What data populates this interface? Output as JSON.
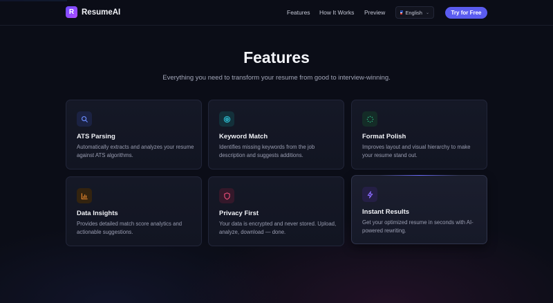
{
  "nav": {
    "brand_letter": "R",
    "brand_name": "ResumeAI",
    "links": [
      "Features",
      "How It Works",
      "Preview"
    ],
    "language": "English",
    "cta": "Try for Free"
  },
  "hero": {
    "title": "Features",
    "subtitle": "Everything you need to transform your resume from good to interview-winning."
  },
  "features": [
    {
      "title": "ATS Parsing",
      "desc": "Automatically extracts and analyzes your resume against ATS algorithms.",
      "icon": "search-icon",
      "color": "#6b8cff"
    },
    {
      "title": "Keyword Match",
      "desc": "Identifies missing keywords from the job description and suggests additions.",
      "icon": "target-icon",
      "color": "#2ec4d9"
    },
    {
      "title": "Format Polish",
      "desc": "Improves layout and visual hierarchy to make your resume stand out.",
      "icon": "loader-icon",
      "color": "#2fbf8a"
    },
    {
      "title": "Data Insights",
      "desc": "Provides detailed match score analytics and actionable suggestions.",
      "icon": "bar-chart-icon",
      "color": "#f08c2e"
    },
    {
      "title": "Privacy First",
      "desc": "Your data is encrypted and never stored. Upload, analyze, download — done.",
      "icon": "shield-icon",
      "color": "#ef4f7a"
    },
    {
      "title": "Instant Results",
      "desc": "Get your optimized resume in seconds with AI-powered rewriting.",
      "icon": "lightning-icon",
      "color": "#8b6cff"
    }
  ],
  "colors": {
    "accent": "#5b5cf0",
    "background": "#0b0d17"
  }
}
